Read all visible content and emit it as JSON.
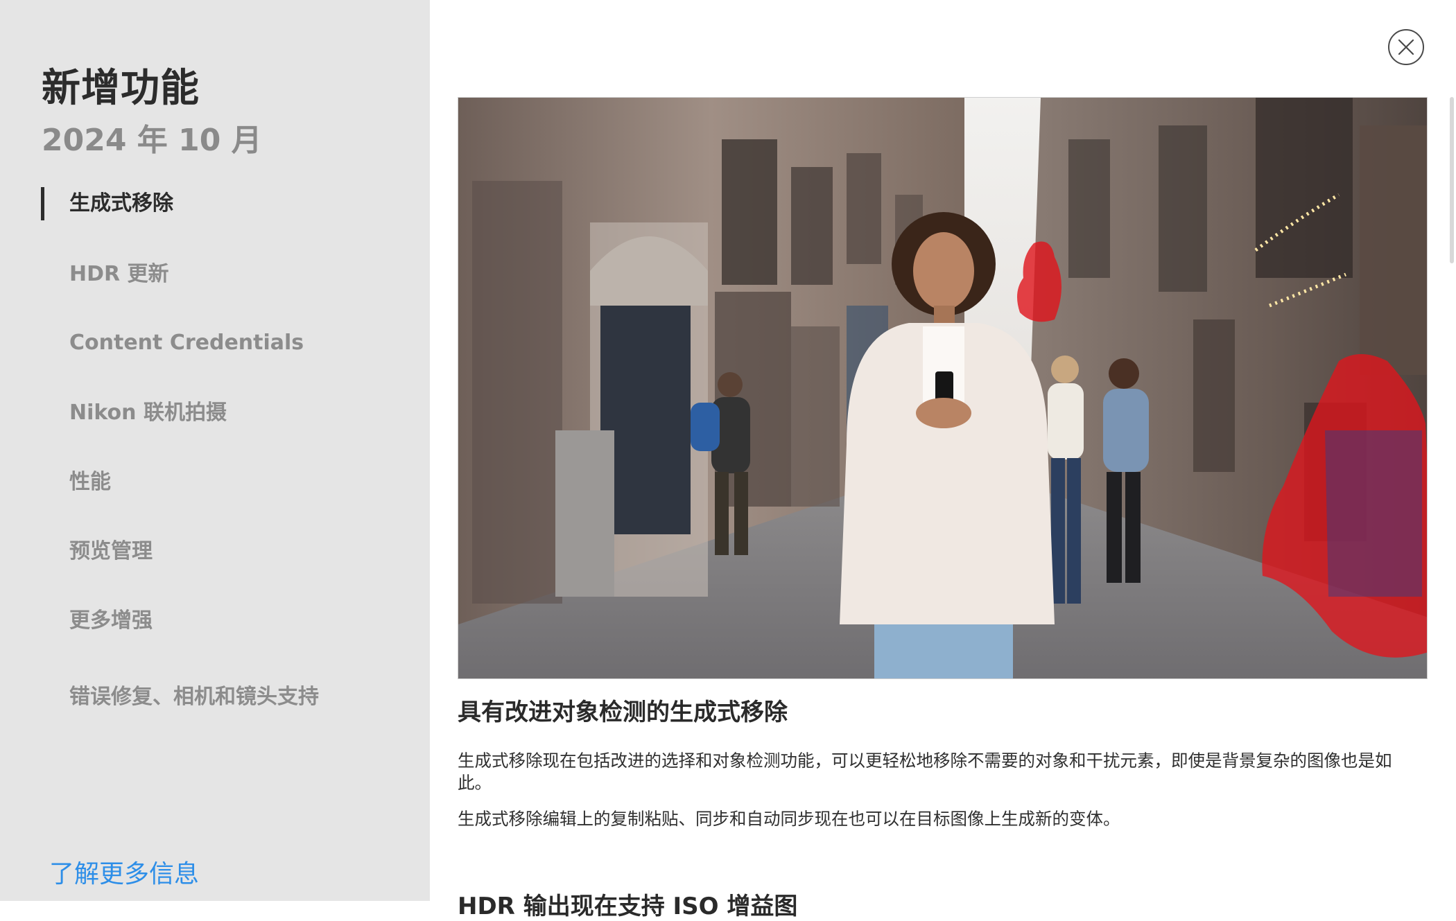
{
  "sidebar": {
    "title": "新增功能",
    "subtitle": "2024 年 10 月",
    "items": [
      {
        "label": "生成式移除",
        "active": true
      },
      {
        "label": "HDR 更新"
      },
      {
        "label": "Content Credentials"
      },
      {
        "label": "Nikon 联机拍摄"
      },
      {
        "label": "性能"
      },
      {
        "label": "预览管理"
      },
      {
        "label": "更多增强"
      },
      {
        "label": "错误修复、相机和镜头支持"
      }
    ],
    "learn_more": "了解更多信息"
  },
  "main": {
    "feature_heading": "具有改进对象检测的生成式移除",
    "paragraphs": [
      "生成式移除现在包括改进的选择和对象检测功能，可以更轻松地移除不需要的对象和干扰元素，即使是背景复杂的图像也是如此。",
      "生成式移除编辑上的复制粘贴、同步和自动同步现在也可以在目标图像上生成新的变体。"
    ],
    "next_heading": "HDR 输出现在支持 ISO 增益图"
  },
  "icons": {
    "close": "close-icon"
  },
  "colors": {
    "sidebar_bg": "#e5e5e5",
    "link": "#2d8ee8",
    "selection_overlay": "#e0141c"
  }
}
